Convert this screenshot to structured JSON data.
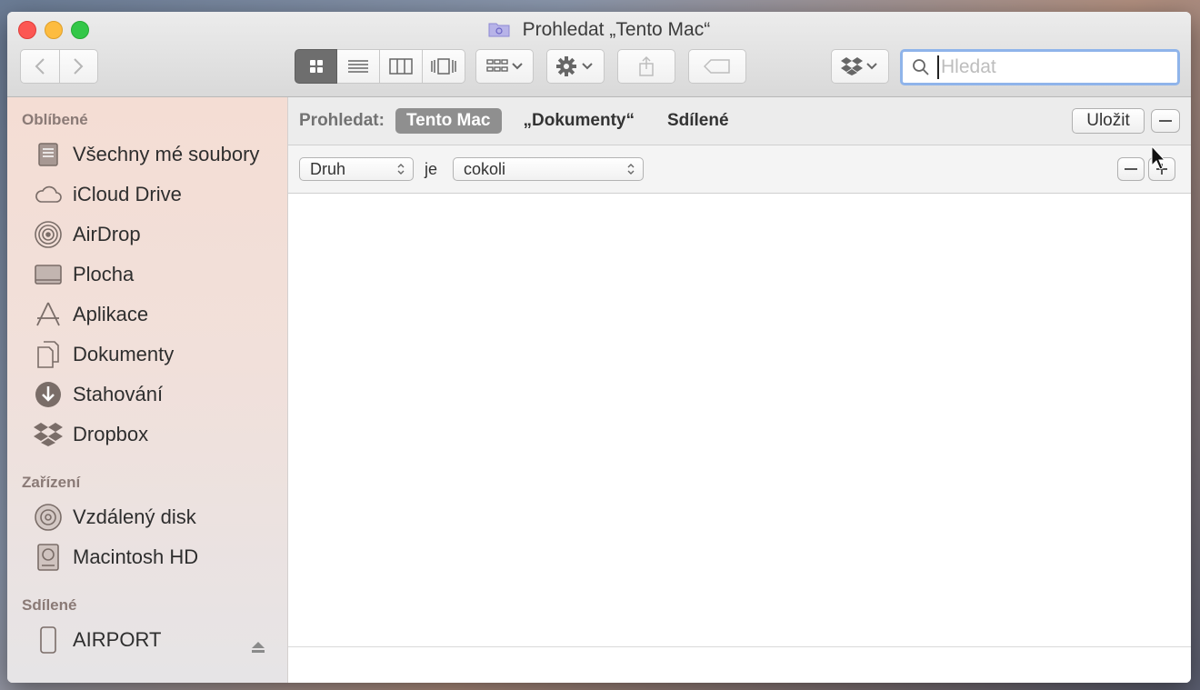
{
  "window": {
    "title": "Prohledat „Tento Mac“"
  },
  "toolbar": {
    "back_icon": "chevron-left-icon",
    "forward_icon": "chevron-right-icon",
    "view_modes": [
      "icon-view-icon",
      "list-view-icon",
      "column-view-icon",
      "cover-flow-icon"
    ],
    "group_icon": "group-icon",
    "action_icon": "gear-icon",
    "share_icon": "share-icon",
    "tag_icon": "tag-icon",
    "dropbox_icon": "dropbox-icon",
    "search": {
      "placeholder": "Hledat",
      "value": ""
    }
  },
  "sidebar": {
    "favorites_header": "Oblíbené",
    "favorites": [
      {
        "label": "Všechny mé soubory",
        "icon": "all-files-icon"
      },
      {
        "label": "iCloud Drive",
        "icon": "cloud-icon"
      },
      {
        "label": "AirDrop",
        "icon": "airdrop-icon"
      },
      {
        "label": "Plocha",
        "icon": "desktop-icon"
      },
      {
        "label": "Aplikace",
        "icon": "applications-icon"
      },
      {
        "label": "Dokumenty",
        "icon": "documents-icon"
      },
      {
        "label": "Stahování",
        "icon": "download-icon"
      },
      {
        "label": "Dropbox",
        "icon": "dropbox-icon"
      }
    ],
    "devices_header": "Zařízení",
    "devices": [
      {
        "label": "Vzdálený disk",
        "icon": "disc-icon"
      },
      {
        "label": "Macintosh HD",
        "icon": "hard-drive-icon"
      }
    ],
    "shared_header": "Sdílené",
    "shared": [
      {
        "label": "AIRPORT",
        "icon": "airport-icon"
      }
    ]
  },
  "scope": {
    "label": "Prohledat:",
    "options": [
      "Tento Mac",
      "„Dokumenty“",
      "Sdílené"
    ],
    "active": "Tento Mac",
    "save_label": "Uložit"
  },
  "criteria": {
    "attribute": "Druh",
    "relation": "je",
    "value": "cokoli"
  },
  "colors": {
    "close": "#fc5753",
    "minimize": "#fdbc40",
    "maximize": "#33c748",
    "search_focus": "#8fb4ea",
    "scope_active": "#8f8f8f"
  }
}
